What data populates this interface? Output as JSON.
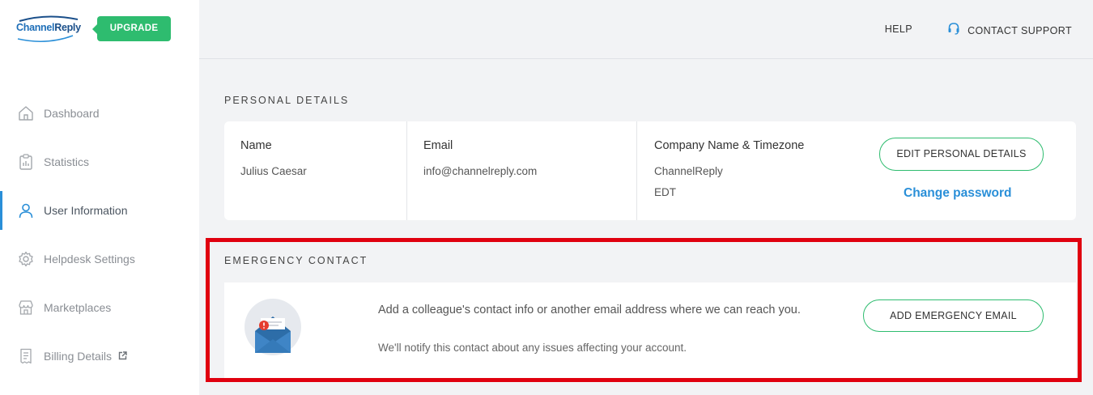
{
  "brand": {
    "logo_text_1": "Channel",
    "logo_text_2": "Reply",
    "upgrade_label": "UPGRADE",
    "accent_color": "#2ebc6f",
    "link_color": "#2a8fd8"
  },
  "sidebar": {
    "items": [
      {
        "label": "Dashboard",
        "icon": "home-icon"
      },
      {
        "label": "Statistics",
        "icon": "clipboard-chart-icon"
      },
      {
        "label": "User Information",
        "icon": "user-icon",
        "active": true
      },
      {
        "label": "Helpdesk Settings",
        "icon": "gear-icon"
      },
      {
        "label": "Marketplaces",
        "icon": "storefront-icon"
      },
      {
        "label": "Billing Details",
        "icon": "receipt-icon",
        "external_icon": "external-link-icon"
      }
    ]
  },
  "topbar": {
    "help_label": "HELP",
    "support_label": "CONTACT SUPPORT",
    "support_icon": "headset-icon"
  },
  "personal": {
    "title": "PERSONAL DETAILS",
    "name_label": "Name",
    "name_value": "Julius Caesar",
    "email_label": "Email",
    "email_value": "info@channelreply.com",
    "company_label": "Company Name & Timezone",
    "company_value": "ChannelReply",
    "timezone_value": "EDT",
    "edit_label": "EDIT PERSONAL DETAILS",
    "change_password_label": "Change password"
  },
  "emergency": {
    "title": "EMERGENCY CONTACT",
    "description": "Add a colleague's contact info or another email address where we can reach you.",
    "note": "We'll notify this contact about any issues affecting your account.",
    "add_label": "ADD EMERGENCY EMAIL",
    "illustration_icon": "envelope-alert-icon",
    "highlight_color": "#e0000f"
  }
}
